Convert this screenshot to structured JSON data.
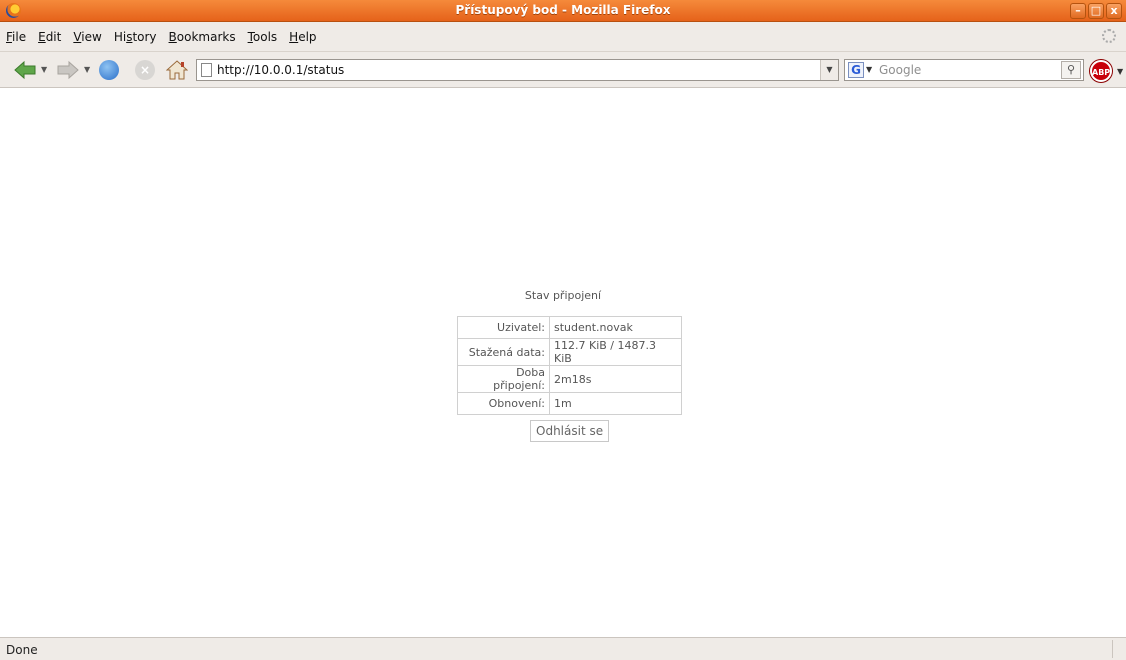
{
  "window": {
    "title": "Přístupový bod - Mozilla Firefox",
    "controls": [
      "–",
      "□",
      "x"
    ]
  },
  "menu": {
    "items": [
      {
        "pre": "",
        "key": "F",
        "post": "ile"
      },
      {
        "pre": "",
        "key": "E",
        "post": "dit"
      },
      {
        "pre": "",
        "key": "V",
        "post": "iew"
      },
      {
        "pre": "Hi",
        "key": "s",
        "post": "tory"
      },
      {
        "pre": "",
        "key": "B",
        "post": "ookmarks"
      },
      {
        "pre": "",
        "key": "T",
        "post": "ools"
      },
      {
        "pre": "",
        "key": "H",
        "post": "elp"
      }
    ]
  },
  "navbar": {
    "url": "http://10.0.0.1/status",
    "search_placeholder": "Google",
    "search_engine_letter": "G",
    "adblock_label": "ABP"
  },
  "page": {
    "heading": "Stav připojení",
    "rows": [
      {
        "label": "Uzivatel:",
        "value": "student.novak"
      },
      {
        "label": "Stažená data:",
        "value": "112.7 KiB / 1487.3 KiB"
      },
      {
        "label": "Doba připojení:",
        "value": "2m18s"
      },
      {
        "label": "Obnovení:",
        "value": "1m"
      }
    ],
    "logout_label": "Odhlásit se"
  },
  "statusbar": {
    "text": "Done"
  },
  "colors": {
    "titlebar": "#e5621a",
    "chrome": "#efebe7"
  }
}
